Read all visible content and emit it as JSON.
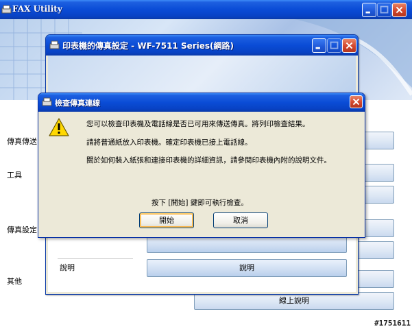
{
  "main_window": {
    "title": "FAX Utility",
    "side_labels": [
      "傳真傳送",
      "工具",
      "傳真設定",
      "其他"
    ],
    "buttons": {
      "online_help": "線上說明"
    }
  },
  "settings_window": {
    "title": "印表機的傳真設定 - WF-7511 Series(網路)",
    "section_help": "說明",
    "help_button": "說明"
  },
  "dialog": {
    "title": "檢查傳真連線",
    "icon": "warning-icon",
    "messages": [
      "您可以檢查印表機及電話線是否已可用來傳送傳真。將列印檢查結果。",
      "請將普通紙放入印表機。確定印表機已接上電話線。",
      "關於如何裝入紙張和連接印表機的詳細資訊，請參閱印表機內附的說明文件。"
    ],
    "prompt": "按下 [開始] 鍵即可執行檢查。",
    "start_button": "開始",
    "cancel_button": "取消"
  },
  "watermark": "#1751611",
  "colors": {
    "titlebar": "#0a4cd6",
    "close_button": "#d3462d",
    "dialog_face": "#ece9d8",
    "warning_yellow": "#ffd800"
  }
}
